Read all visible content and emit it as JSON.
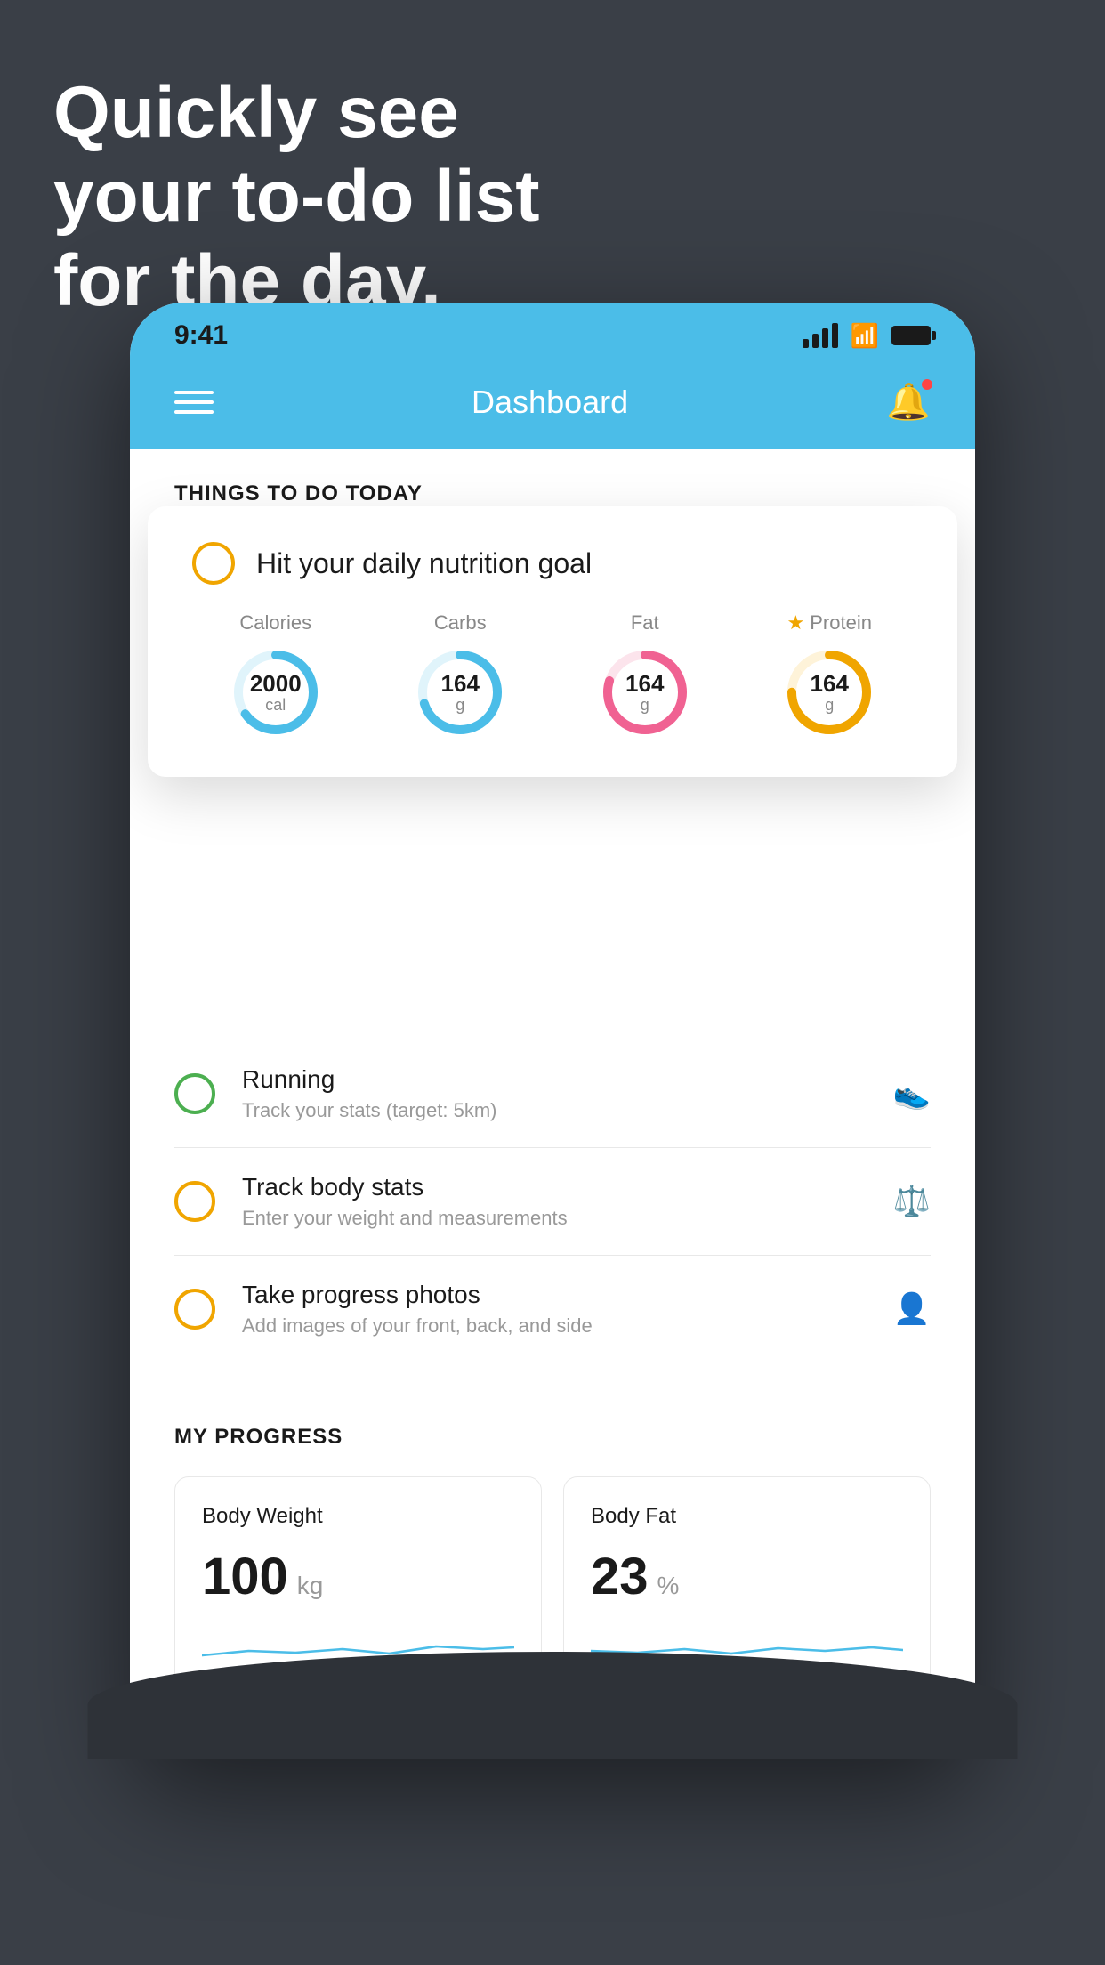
{
  "hero": {
    "line1": "Quickly see",
    "line2": "your to-do list",
    "line3": "for the day."
  },
  "status_bar": {
    "time": "9:41"
  },
  "header": {
    "title": "Dashboard"
  },
  "things_section": {
    "title": "THINGS TO DO TODAY"
  },
  "nutrition_card": {
    "circle_type": "yellow_outline",
    "title": "Hit your daily nutrition goal",
    "items": [
      {
        "label": "Calories",
        "value": "2000",
        "unit": "cal",
        "color": "#4bbde8",
        "track_percent": 65
      },
      {
        "label": "Carbs",
        "value": "164",
        "unit": "g",
        "color": "#4bbde8",
        "track_percent": 70
      },
      {
        "label": "Fat",
        "value": "164",
        "unit": "g",
        "color": "#f06292",
        "track_percent": 80
      },
      {
        "label": "Protein",
        "value": "164",
        "unit": "g",
        "color": "#f0a500",
        "track_percent": 75,
        "starred": true
      }
    ]
  },
  "todo_items": [
    {
      "circle_color": "green",
      "title": "Running",
      "subtitle": "Track your stats (target: 5km)",
      "icon": "shoe"
    },
    {
      "circle_color": "yellow",
      "title": "Track body stats",
      "subtitle": "Enter your weight and measurements",
      "icon": "scale"
    },
    {
      "circle_color": "yellow",
      "title": "Take progress photos",
      "subtitle": "Add images of your front, back, and side",
      "icon": "person"
    }
  ],
  "progress": {
    "title": "MY PROGRESS",
    "cards": [
      {
        "title": "Body Weight",
        "value": "100",
        "unit": "kg"
      },
      {
        "title": "Body Fat",
        "value": "23",
        "unit": "%"
      }
    ]
  }
}
